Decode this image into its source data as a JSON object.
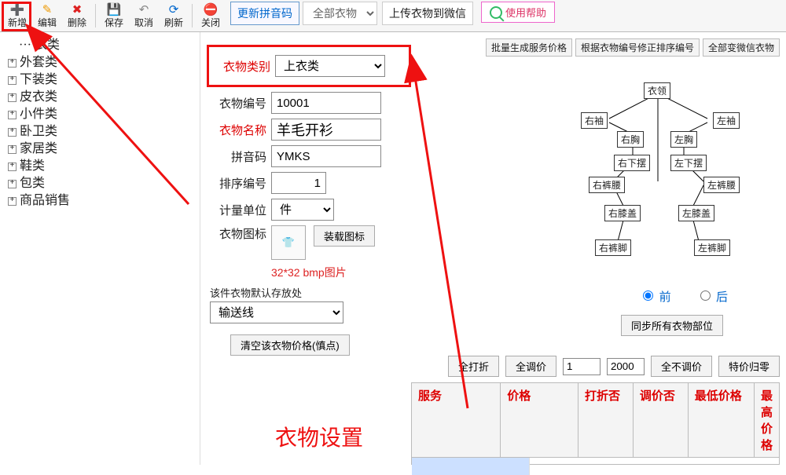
{
  "toolbar": {
    "new": "新增",
    "edit": "编辑",
    "delete": "删除",
    "save": "保存",
    "cancel": "取消",
    "refresh": "刷新",
    "close": "关闭",
    "update_pinyin": "更新拼音码",
    "all_clothes": "全部衣物",
    "upload_wechat": "上传衣物到微信",
    "help": "使用帮助"
  },
  "top_links": {
    "batch_price": "批量生成服务价格",
    "fix_order": "根据衣物编号修正排序编号",
    "all_wechat": "全部变微信衣物"
  },
  "tree": [
    "衣类",
    "外套类",
    "下装类",
    "皮衣类",
    "小件类",
    "卧卫类",
    "家居类",
    "鞋类",
    "包类",
    "商品销售"
  ],
  "form": {
    "category_label": "衣物类别",
    "category_value": "上衣类",
    "code_label": "衣物编号",
    "code_value": "10001",
    "name_label": "衣物名称",
    "name_value": "羊毛开衫",
    "pinyin_label": "拼音码",
    "pinyin_value": "YMKS",
    "order_label": "排序编号",
    "order_value": "1",
    "unit_label": "计量单位",
    "unit_value": "件",
    "icon_label": "衣物图标",
    "load_icon": "装载图标",
    "icon_note": "32*32 bmp图片",
    "default_loc_label": "该件衣物默认存放处",
    "default_loc_value": "输送线",
    "clear_price": "清空该衣物价格(慎点)"
  },
  "diagram_parts": {
    "collar": "衣领",
    "r_sleeve": "右袖",
    "l_sleeve": "左袖",
    "r_chest": "右胸",
    "l_chest": "左胸",
    "r_hem": "右下摆",
    "l_hem": "左下摆",
    "r_waist": "右裤腰",
    "l_waist": "左裤腰",
    "r_knee": "右膝盖",
    "l_knee": "左膝盖",
    "r_foot": "右裤脚",
    "l_foot": "左裤脚"
  },
  "radios": {
    "front": "前",
    "back": "后"
  },
  "sync_parts": "同步所有衣物部位",
  "price_bar": {
    "all_discount": "全打折",
    "all_adjust": "全调价",
    "v1": "1",
    "v2": "2000",
    "all_noadjust": "全不调价",
    "special_zero": "特价归零"
  },
  "table_headers": {
    "service": "服务",
    "price": "价格",
    "discount": "打折否",
    "adjust": "调价否",
    "min": "最低价格",
    "max": "最高价格"
  },
  "annotation": "衣物设置"
}
